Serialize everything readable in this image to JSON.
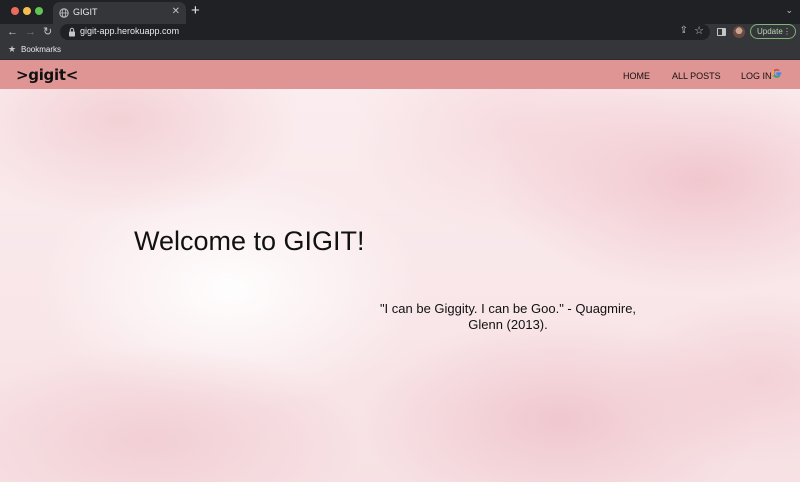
{
  "browser": {
    "tab": {
      "title": "GIGIT",
      "favicon": "globe-icon"
    },
    "url": "gigit-app.herokuapp.com",
    "update_label": "Update",
    "bookmarks_label": "Bookmarks"
  },
  "site": {
    "logo_text": ">gigit<",
    "nav": {
      "home": "HOME",
      "all_posts": "ALL POSTS",
      "login": "LOG IN"
    },
    "nav_color": "#df9593"
  },
  "main": {
    "heading": "Welcome to GIGIT!",
    "quote_line1": "\"I can be Giggity. I can be Goo.\" - Quagmire,",
    "quote_line2": "Glenn (2013)."
  }
}
